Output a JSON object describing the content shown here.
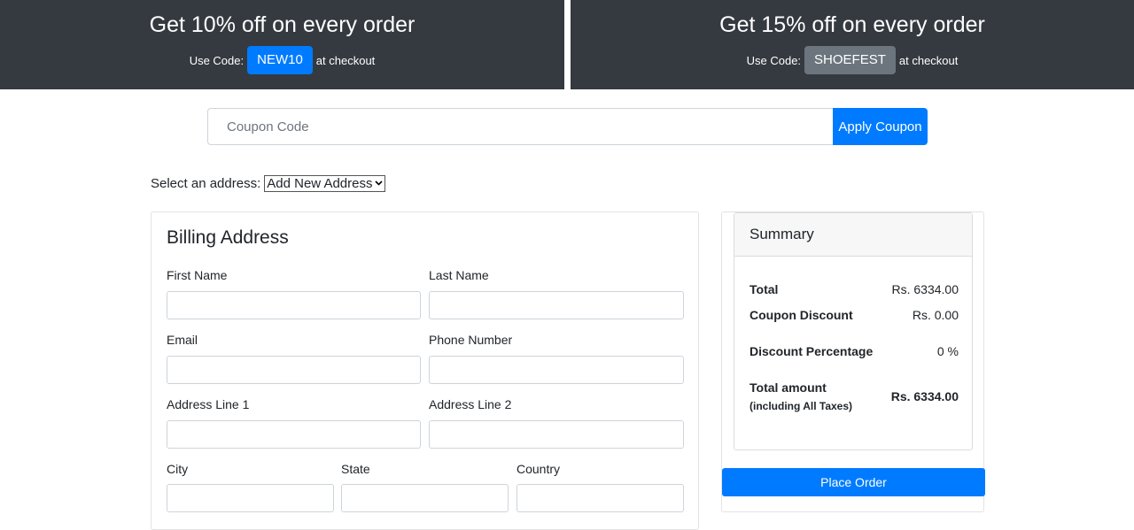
{
  "promos": [
    {
      "headline": "Get 10% off on every order",
      "use_code_label": "Use Code:",
      "code": "NEW10",
      "suffix": "at checkout",
      "code_color": "#007bff"
    },
    {
      "headline": "Get 15% off on every order",
      "use_code_label": "Use Code:",
      "code": "SHOEFEST",
      "suffix": "at checkout",
      "code_color": "#6c757d"
    }
  ],
  "coupon": {
    "placeholder": "Coupon Code",
    "apply_label": "Apply Coupon"
  },
  "address_select": {
    "label": "Select an address:",
    "selected": "Add New Address"
  },
  "billing": {
    "title": "Billing Address",
    "fields": {
      "first_name": "First Name",
      "last_name": "Last Name",
      "email": "Email",
      "phone": "Phone Number",
      "address1": "Address Line 1",
      "address2": "Address Line 2",
      "city": "City",
      "state": "State",
      "country": "Country"
    }
  },
  "summary": {
    "title": "Summary",
    "total_label": "Total",
    "total_value": "Rs. 6334.00",
    "discount_label": "Coupon Discount",
    "discount_value": "Rs. 0.00",
    "percentage_label": "Discount Percentage",
    "percentage_value": "0 %",
    "amount_label": "Total amount",
    "amount_sub": "(including All Taxes)",
    "amount_value": "Rs. 6334.00"
  },
  "place_order_label": "Place Order",
  "colors": {
    "banner_bg": "#343a40",
    "primary": "#007bff",
    "secondary": "#6c757d"
  }
}
